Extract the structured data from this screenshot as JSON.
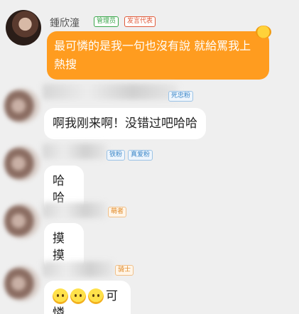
{
  "messages": [
    {
      "username": "鍾欣潼",
      "badges": [
        "管理员",
        "发言代表"
      ],
      "text": "最可憐的是我一句也沒有說 就給罵我上熱搜"
    },
    {
      "badges": [
        "死忠粉"
      ],
      "text": "啊我刚来啊！没错过吧哈哈"
    },
    {
      "badges": [
        "铁粉",
        "真爱粉"
      ],
      "text": "哈哈"
    },
    {
      "badges": [
        "萌者"
      ],
      "text": "摸摸"
    },
    {
      "badges": [
        "骑士"
      ],
      "emoji": [
        "pleading-face-icon",
        "pleading-face-icon",
        "pleading-face-icon"
      ],
      "text": "可憐"
    }
  ],
  "colors": {
    "background": "#efefef",
    "highlight_bubble": "#ff9c1f",
    "admin_badge": "#3aa64a",
    "speaker_badge": "#e05a3a"
  }
}
